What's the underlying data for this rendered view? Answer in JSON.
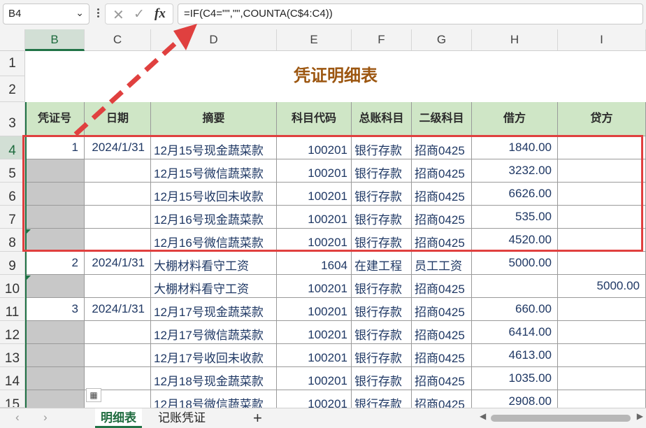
{
  "name_box": "B4",
  "formula_bar": {
    "cancel": "✕",
    "enter": "✓",
    "fx": "fx",
    "formula": "=IF(C4=\"\",\"\",COUNTA(C$4:C4))"
  },
  "columns": [
    "B",
    "C",
    "D",
    "E",
    "F",
    "G",
    "H",
    "I"
  ],
  "row_numbers": [
    "1",
    "2",
    "3",
    "4",
    "5",
    "6",
    "7",
    "8",
    "9",
    "10",
    "11",
    "12",
    "13",
    "14",
    "15"
  ],
  "sheet_title": "凭证明细表",
  "table_headers": [
    "凭证号",
    "日期",
    "摘要",
    "科目代码",
    "总账科目",
    "二级科目",
    "借方",
    "贷方"
  ],
  "rows": [
    {
      "voucher": "1",
      "date": "2024/1/31",
      "summary": "12月15号现金蔬菜款",
      "code": "100201",
      "account": "银行存款",
      "sub": "招商0425",
      "debit": "1840.00",
      "credit": ""
    },
    {
      "voucher": "",
      "date": "",
      "summary": "12月15号微信蔬菜款",
      "code": "100201",
      "account": "银行存款",
      "sub": "招商0425",
      "debit": "3232.00",
      "credit": ""
    },
    {
      "voucher": "",
      "date": "",
      "summary": "12月15号收回未收款",
      "code": "100201",
      "account": "银行存款",
      "sub": "招商0425",
      "debit": "6626.00",
      "credit": ""
    },
    {
      "voucher": "",
      "date": "",
      "summary": "12月16号现金蔬菜款",
      "code": "100201",
      "account": "银行存款",
      "sub": "招商0425",
      "debit": "535.00",
      "credit": ""
    },
    {
      "voucher": "",
      "date": "",
      "summary": "12月16号微信蔬菜款",
      "code": "100201",
      "account": "银行存款",
      "sub": "招商0425",
      "debit": "4520.00",
      "credit": ""
    },
    {
      "voucher": "2",
      "date": "2024/1/31",
      "summary": "大棚材料看守工资",
      "code": "1604",
      "account": "在建工程",
      "sub": "员工工资",
      "debit": "5000.00",
      "credit": ""
    },
    {
      "voucher": "",
      "date": "",
      "summary": "大棚材料看守工资",
      "code": "100201",
      "account": "银行存款",
      "sub": "招商0425",
      "debit": "",
      "credit": "5000.00"
    },
    {
      "voucher": "3",
      "date": "2024/1/31",
      "summary": "12月17号现金蔬菜款",
      "code": "100201",
      "account": "银行存款",
      "sub": "招商0425",
      "debit": "660.00",
      "credit": ""
    },
    {
      "voucher": "",
      "date": "",
      "summary": "12月17号微信蔬菜款",
      "code": "100201",
      "account": "银行存款",
      "sub": "招商0425",
      "debit": "6414.00",
      "credit": ""
    },
    {
      "voucher": "",
      "date": "",
      "summary": "12月17号收回未收款",
      "code": "100201",
      "account": "银行存款",
      "sub": "招商0425",
      "debit": "4613.00",
      "credit": ""
    },
    {
      "voucher": "",
      "date": "",
      "summary": "12月18号现金蔬菜款",
      "code": "100201",
      "account": "银行存款",
      "sub": "招商0425",
      "debit": "1035.00",
      "credit": ""
    },
    {
      "voucher": "",
      "date": "",
      "summary": "12月18号微信蔬菜款",
      "code": "100201",
      "account": "银行存款",
      "sub": "招商0425",
      "debit": "2908.00",
      "credit": ""
    }
  ],
  "sheet_tabs": [
    "明细表",
    "记账凭证"
  ],
  "add_sheet": "+",
  "nav_prev": "‹",
  "nav_next": "›",
  "colors": {
    "header_fill": "#cfe6c6",
    "title": "#9c5610",
    "highlight_box": "#e0403f",
    "selected": "#217346"
  }
}
